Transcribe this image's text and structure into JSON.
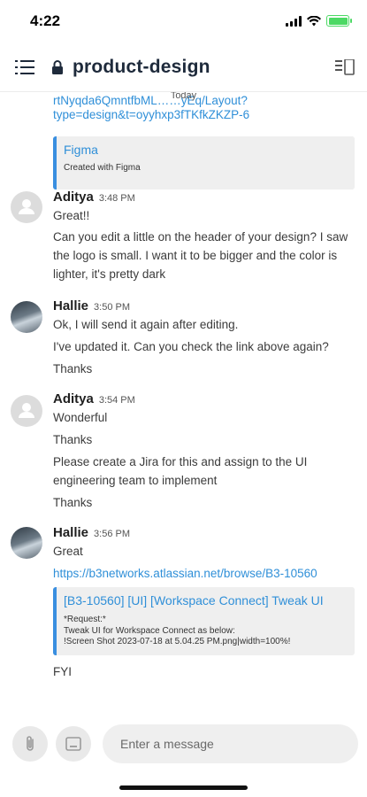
{
  "status_bar": {
    "time": "4:22"
  },
  "header": {
    "channel_name": "product-design"
  },
  "day_separator": "Today",
  "top_partial": {
    "link_line1": "rtNyqda6QmntfbML……yEq/Layout?",
    "link_line2": "type=design&t=oyyhxp3fTKfkZKZP-6",
    "card_title": "Figma",
    "card_desc": "Created with Figma"
  },
  "messages": [
    {
      "author": "Aditya",
      "time": "3:48 PM",
      "lines": [
        "Great!!",
        "Can you edit a little on the header of your design? I saw the logo is small. I want it to be bigger and the color is lighter, it's pretty dark"
      ]
    },
    {
      "author": "Hallie",
      "time": "3:50 PM",
      "lines": [
        "Ok, I will send it again after editing.",
        "I've updated it. Can you check the link above again?",
        "Thanks"
      ]
    },
    {
      "author": "Aditya",
      "time": "3:54 PM",
      "lines": [
        "Wonderful",
        "Thanks",
        "Please create a Jira for this and assign to the UI engineering team to implement",
        "Thanks"
      ]
    },
    {
      "author": "Hallie",
      "time": "3:56 PM",
      "lines": [
        "Great"
      ],
      "link": "https://b3networks.atlassian.net/browse/B3-10560",
      "card_title": "[B3-10560] [UI] [Workspace Connect] Tweak UI",
      "card_desc_1": "*Request:*",
      "card_desc_2": "Tweak UI for Workspace Connect as below:",
      "card_desc_3": "!Screen Shot 2023-07-18 at 5.04.25 PM.png|width=100%!",
      "after": "FYI"
    }
  ],
  "composer": {
    "placeholder": "Enter a message"
  },
  "icons": {
    "menu": "menu-icon",
    "lock": "lock-icon",
    "sidebar": "sidebar-toggle-icon",
    "attach": "paperclip-icon",
    "image": "image-icon",
    "avatar_default": "person-icon"
  },
  "colors": {
    "link": "#2f8fd8",
    "card_accent": "#3a8fe0",
    "title": "#1e2a3b",
    "battery": "#4cd964"
  }
}
